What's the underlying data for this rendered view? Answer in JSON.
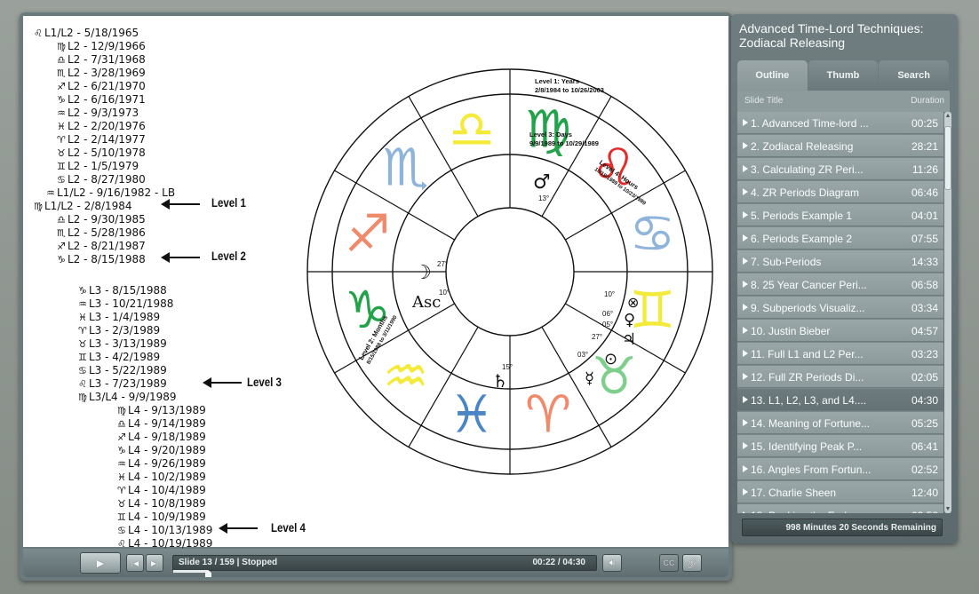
{
  "tree": [
    {
      "glyph": "♌",
      "text": "L1/L2 - 5/18/1965",
      "level": 0
    },
    {
      "glyph": "♍",
      "text": "L2 - 12/9/1966",
      "level": 1
    },
    {
      "glyph": "♎",
      "text": "L2 - 7/31/1968",
      "level": 1
    },
    {
      "glyph": "♏",
      "text": "L2 - 3/28/1969",
      "level": 1
    },
    {
      "glyph": "♐",
      "text": "L2 - 6/21/1970",
      "level": 1
    },
    {
      "glyph": "♑",
      "text": "L2 - 6/16/1971",
      "level": 1
    },
    {
      "glyph": "♒",
      "text": "L2 - 9/3/1973",
      "level": 1
    },
    {
      "glyph": "♓",
      "text": "L2 - 2/20/1976",
      "level": 1
    },
    {
      "glyph": "♈",
      "text": "L2 - 2/14/1977",
      "level": 1
    },
    {
      "glyph": "♉",
      "text": "L2 - 5/10/1978",
      "level": 1
    },
    {
      "glyph": "♊",
      "text": "L2 - 1/5/1979",
      "level": 1
    },
    {
      "glyph": "♋",
      "text": "L2 - 8/27/1980",
      "level": 1
    },
    {
      "glyph": "♒",
      "text": "L1/L2 - 9/16/1982 - LB",
      "level": 0.6
    },
    {
      "glyph": "♍",
      "text": "L1/L2 - 2/8/1984",
      "level": 0
    },
    {
      "glyph": "♎",
      "text": "L2 - 9/30/1985",
      "level": 1
    },
    {
      "glyph": "♏",
      "text": "L2 - 5/28/1986",
      "level": 1
    },
    {
      "glyph": "♐",
      "text": "L2 - 8/21/1987",
      "level": 1
    },
    {
      "glyph": "♑",
      "text": "L2 - 8/15/1988",
      "level": 1
    },
    {
      "glyph": "♑",
      "text": "L3 - 8/15/1988",
      "level": 2
    },
    {
      "glyph": "♒",
      "text": "L3 - 10/21/1988",
      "level": 2
    },
    {
      "glyph": "♓",
      "text": "L3 - 1/4/1989",
      "level": 2
    },
    {
      "glyph": "♈",
      "text": "L3 - 2/3/1989",
      "level": 2
    },
    {
      "glyph": "♉",
      "text": "L3 - 3/13/1989",
      "level": 2
    },
    {
      "glyph": "♊",
      "text": "L3 - 4/2/1989",
      "level": 2
    },
    {
      "glyph": "♋",
      "text": "L3 - 5/22/1989",
      "level": 2
    },
    {
      "glyph": "♌",
      "text": "L3 - 7/23/1989",
      "level": 2
    },
    {
      "glyph": "♍",
      "text": "L3/L4 - 9/9/1989",
      "level": 2
    },
    {
      "glyph": "♍",
      "text": "L4 - 9/13/1989",
      "level": 3
    },
    {
      "glyph": "♎",
      "text": "L4 - 9/14/1989",
      "level": 3
    },
    {
      "glyph": "♐",
      "text": "L4 - 9/18/1989",
      "level": 3
    },
    {
      "glyph": "♑",
      "text": "L4 - 9/20/1989",
      "level": 3
    },
    {
      "glyph": "♒",
      "text": "L4 - 9/26/1989",
      "level": 3
    },
    {
      "glyph": "♓",
      "text": "L4 - 10/2/1989",
      "level": 3
    },
    {
      "glyph": "♈",
      "text": "L4 - 10/4/1989",
      "level": 3
    },
    {
      "glyph": "♉",
      "text": "L4 - 10/8/1989",
      "level": 3
    },
    {
      "glyph": "♊",
      "text": "L4 - 10/9/1989",
      "level": 3
    },
    {
      "glyph": "♋",
      "text": "L4 - 10/13/1989",
      "level": 3
    },
    {
      "glyph": "♌",
      "text": "L4 - 10/19/1989",
      "level": 3
    }
  ],
  "levels": {
    "level1": "Level 1",
    "level2": "Level 2",
    "level3": "Level 3",
    "level4": "Level 4"
  },
  "chart": {
    "level1_label": "Level 1: Years",
    "level1_range": "2/8/1984 to 10/26/2003",
    "level3_label": "Level 3: Days",
    "level3_range": "9/9/1989 to 10/29/1989",
    "level4_label": "Level 4: Hours",
    "level4_range": "10/19/1989 to 10/23/1989",
    "level2_label": "Level 2: Months",
    "level2_range": "8/15/1988 to 3/11/1990",
    "asc_label": "Asc",
    "asc_deg": "10°",
    "moon_deg": "27°",
    "mars_deg": "13°",
    "saturn_deg": "15°",
    "deg_10": "10°",
    "deg_06": "06°",
    "deg_05": "05°",
    "deg_27": "27°",
    "deg_03": "03°",
    "sign_colors": {
      "virgo": "#22a34a",
      "leo": "#e52a2a",
      "cancer": "#8fb4dc",
      "gemini": "#f4ea3a",
      "taurus": "#7fcf8c",
      "aries": "#ef8a6b",
      "pisces": "#4a86c6",
      "aquarius": "#f4ea3a",
      "capricorn": "#22a34a",
      "sagittarius": "#ef8a6b",
      "scorpio": "#8fb4dc",
      "libra": "#f4ea3a"
    }
  },
  "controls": {
    "slide_status": "Slide 13 / 159 | Stopped",
    "time": "00:22 / 04:30",
    "progress_fraction": 0.081,
    "cc_label": "CC"
  },
  "sidebar": {
    "course_title": "Advanced Time-Lord Techniques: Zodiacal Releasing",
    "tabs": [
      "Outline",
      "Thumb",
      "Search"
    ],
    "col_title": "Slide Title",
    "col_duration": "Duration",
    "slides": [
      {
        "title": "1. Advanced Time-lord ...",
        "duration": "00:25"
      },
      {
        "title": "2. Zodiacal Releasing",
        "duration": "28:21"
      },
      {
        "title": "3. Calculating ZR Peri...",
        "duration": "11:26"
      },
      {
        "title": "4. ZR Periods Diagram",
        "duration": "06:46"
      },
      {
        "title": "5. Periods Example 1",
        "duration": "04:01"
      },
      {
        "title": "6. Periods Example 2",
        "duration": "07:55"
      },
      {
        "title": "7. Sub-Periods",
        "duration": "14:33"
      },
      {
        "title": "8. 25 Year Cancer Peri...",
        "duration": "06:58"
      },
      {
        "title": "9. Subperiods Visualiz...",
        "duration": "03:34"
      },
      {
        "title": "10. Justin Bieber",
        "duration": "04:57"
      },
      {
        "title": "11. Full L1 and L2 Per...",
        "duration": "03:23"
      },
      {
        "title": "12. Full ZR Periods Di...",
        "duration": "02:05"
      },
      {
        "title": "13. L1, L2, L3, and L4....",
        "duration": "04:30"
      },
      {
        "title": "14. Meaning of Fortune...",
        "duration": "05:25"
      },
      {
        "title": "15. Identifying Peak P...",
        "duration": "06:41"
      },
      {
        "title": "16. Angles From Fortun...",
        "duration": "02:52"
      },
      {
        "title": "17. Charlie Sheen",
        "duration": "12:40"
      },
      {
        "title": "18. Peaking the Early ...",
        "duration": "03:58"
      }
    ],
    "current_index": 12,
    "remaining": "998 Minutes 20 Seconds Remaining"
  }
}
